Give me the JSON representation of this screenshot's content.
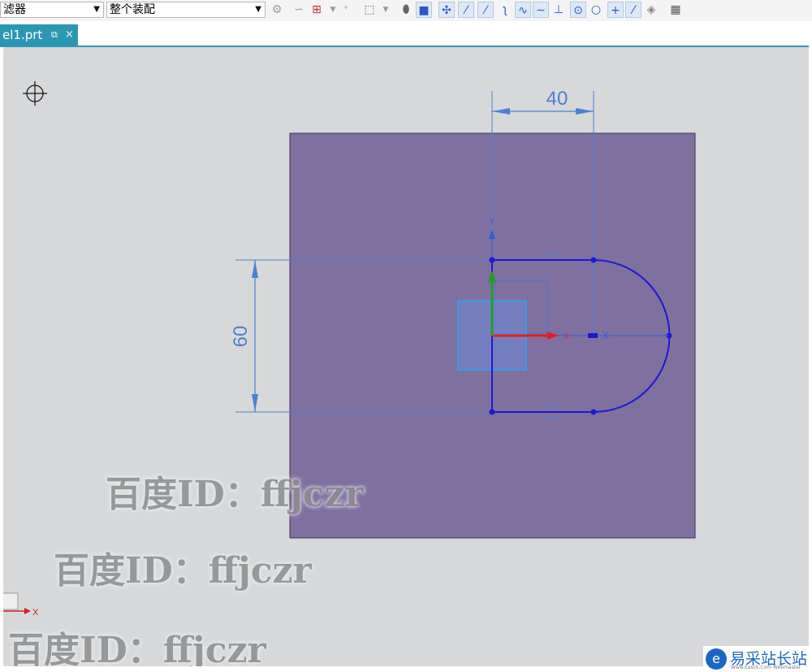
{
  "toolbar": {
    "filter_label": "滤器",
    "scope_label": "整个装配",
    "dropdown_arrow": "▼"
  },
  "tab": {
    "filename": "el1.prt",
    "close_symbol": "×",
    "popout_symbol": "⧉"
  },
  "sketch": {
    "dimension_horizontal": "40",
    "dimension_vertical": "60",
    "axis_x": "X",
    "axis_y": "Y"
  },
  "watermarks": [
    "百度ID：ffjczr",
    "百度ID：ffjczr",
    "百度ID：ffjczr"
  ],
  "badge": {
    "name": "易采站长站",
    "subtitle": "Www.Easck.Com Webmaster"
  },
  "colors": {
    "canvas_bg": "#d6d8da",
    "plate_fill": "#8070a0",
    "sketch_curve": "#1a1ad6",
    "dimension": "#4d7fd6",
    "tab_accent": "#2c97b3"
  }
}
